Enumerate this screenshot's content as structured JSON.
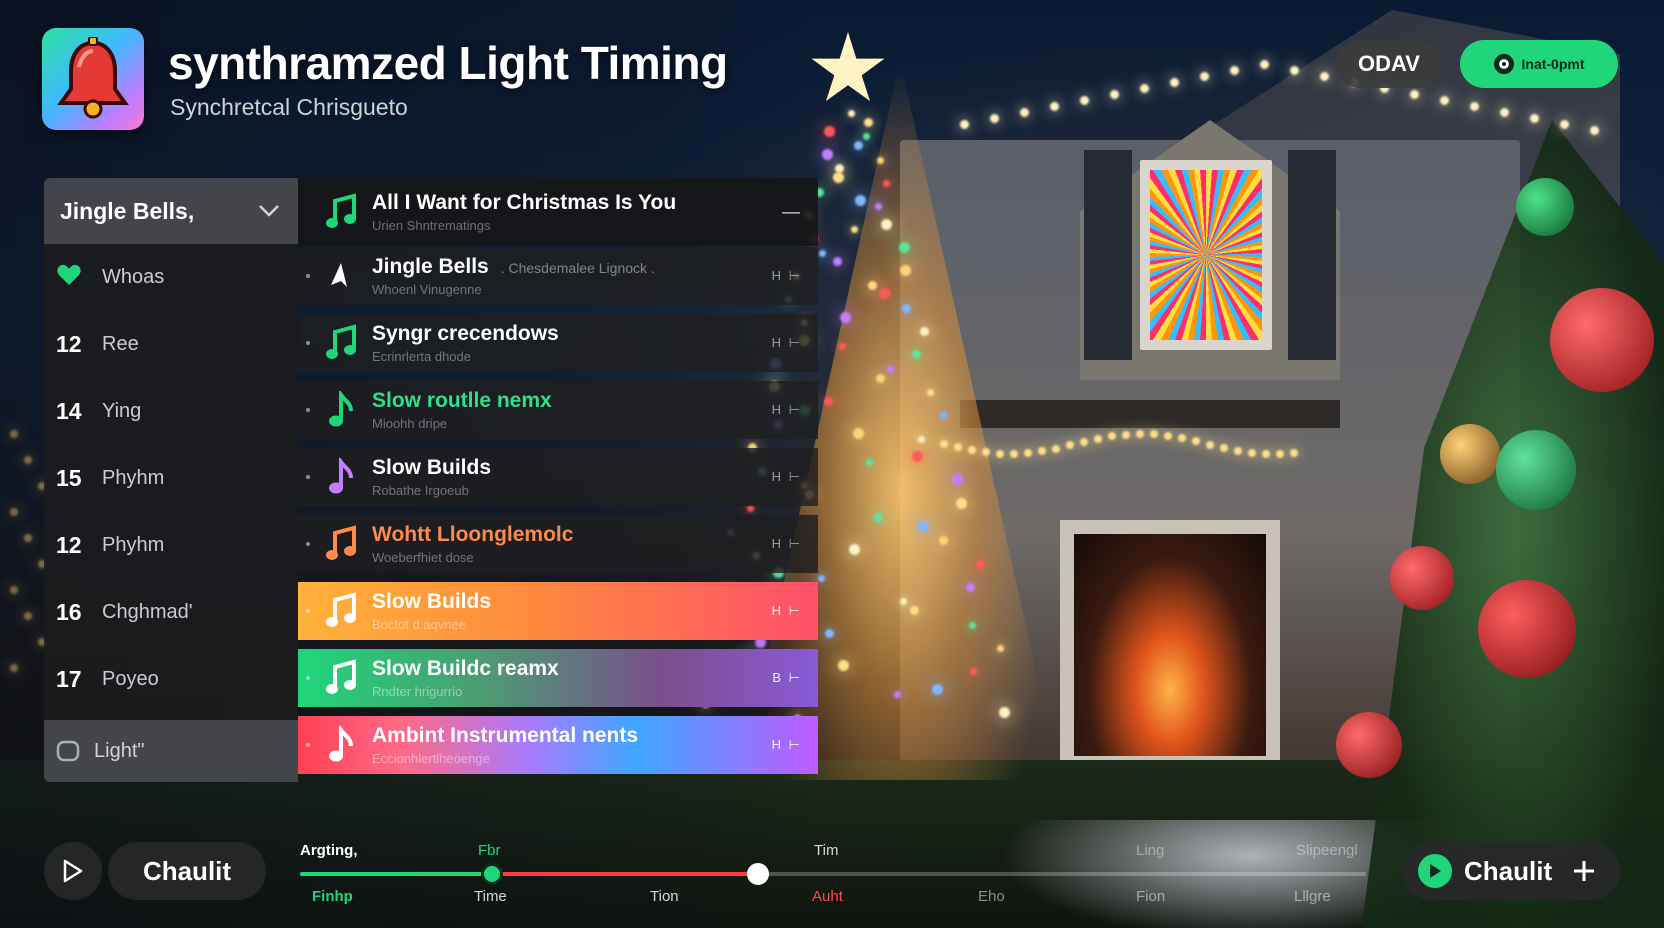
{
  "app": {
    "title": "synthramzed Light Timing",
    "subtitle": "Synchretcal Chrisgueto",
    "icon": "bell-icon"
  },
  "header_buttons": {
    "odav_label": "ODAV",
    "live_label": "Inat-0pmt",
    "accent": "#1fd67a"
  },
  "sidebar": {
    "selected": "Jingle Bells,",
    "items": [
      {
        "num": "",
        "label": "Whoas",
        "icon": "heart-icon"
      },
      {
        "num": "12",
        "label": "Ree"
      },
      {
        "num": "14",
        "label": "Ying"
      },
      {
        "num": "15",
        "label": "Phyhm"
      },
      {
        "num": "12",
        "label": "Phyhm"
      },
      {
        "num": "16",
        "label": "Chghmad'"
      },
      {
        "num": "17",
        "label": "Poyeo"
      }
    ],
    "footer_label": "Light\""
  },
  "tracks": [
    {
      "title": "All I Want for Christmas Is You",
      "sub": "Urien Shntrematings",
      "ctrl": "—",
      "icon": "music-note-icon",
      "note_color": "#1fd67a"
    },
    {
      "title": "Jingle Bells",
      "title_extra": ". Chesdemalee Lignock .",
      "sub": "Whoenl Vinugenne",
      "ctrl": "H ⊢",
      "icon": "star-icon",
      "note_color": "#ffffff"
    },
    {
      "title": "Syngr crecendows",
      "sub": "Ecrinrlerta dhode",
      "ctrl": "H ⊢",
      "icon": "music-note-icon",
      "note_color": "#1fd67a"
    },
    {
      "title": "Slow routlle nemx",
      "sub": "Mioohh dripe",
      "ctrl": "H ⊢",
      "icon": "eighth-note-icon",
      "note_color": "#1fd67a",
      "title_color": "#2fe08a"
    },
    {
      "title": "Slow Builds",
      "sub": "Robathe Irgoeub",
      "ctrl": "H ⊢",
      "icon": "eighth-note-icon",
      "note_color": "#c77dff"
    },
    {
      "title": "Wohtt Lloonglemolc",
      "sub": "Woeberfhiet dose",
      "ctrl": "H ⊢",
      "icon": "music-note-icon",
      "note_color": "#ff8a4c",
      "title_color": "#ff8a4c"
    },
    {
      "title": "Slow Builds",
      "sub": "Boctot d aqvnee",
      "ctrl": "H ⊢",
      "icon": "music-note-icon",
      "note_color": "#ffffff",
      "style": "orange"
    },
    {
      "title": "Slow Buildc reamx",
      "sub": "Rndter hrigurrio",
      "ctrl": "B ⊢",
      "icon": "music-note-icon",
      "note_color": "#ffffff",
      "style": "green"
    },
    {
      "title": "Ambint Instrumental nents",
      "sub": "Eccionhlertlheoenge",
      "ctrl": "H ⊢",
      "icon": "eighth-note-icon",
      "note_color": "#ffffff",
      "style": "rainbow"
    }
  ],
  "bottom": {
    "left_button": "Chaulit",
    "right_button": "Chaulit",
    "timeline_top": [
      "Argting,",
      "Fbr",
      "Tim",
      "Ling",
      "Slipeengl"
    ],
    "timeline_bottom": [
      "Finhp",
      "Time",
      "Tion",
      "Auht",
      "Eho",
      "Fion",
      "Lllgre"
    ],
    "progress_green": 0.18,
    "progress_red_end": 0.43
  }
}
